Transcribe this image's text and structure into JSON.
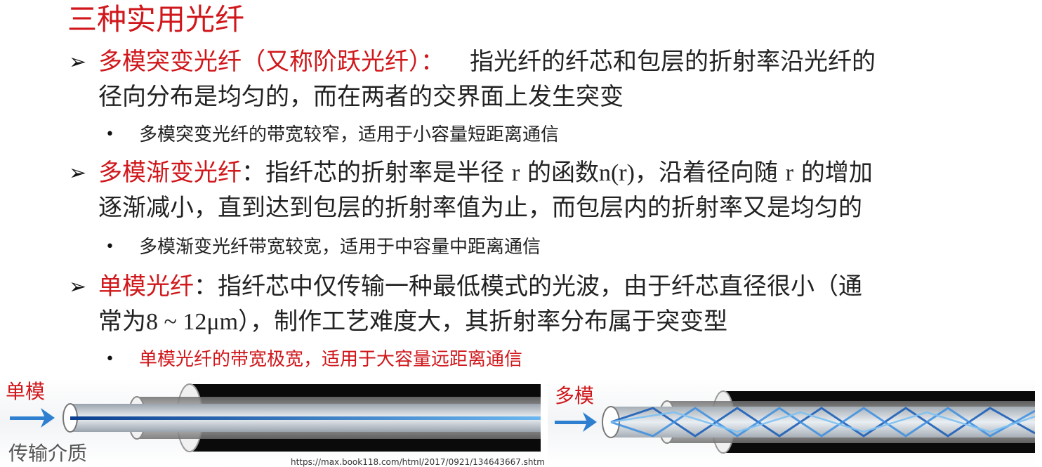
{
  "title": "三种实用光纤",
  "items": [
    {
      "head": "多模突变光纤（又称阶跃光纤）：",
      "line1": "指光纤的纤芯和包层的折射率沿光纤的",
      "line2": "径向分布是均匀的，而在两者的交界面上发生突变",
      "sub": "多模突变光纤的带宽较窄，适用于小容量短距离通信"
    },
    {
      "head": "多模渐变光纤",
      "line1_a": "：指纤芯的折射率是半径",
      "line1_r1": "r",
      "line1_b": "的函数",
      "line1_n": "n(r)",
      "line1_c": "，沿着径向随",
      "line1_r2": "r",
      "line1_d": "的增加",
      "line2": "逐渐减小，直到达到包层的折射率值为止，而包层内的折射率又是均匀的",
      "sub": "多模渐变光纤带宽较宽，适用于中容量中距离通信"
    },
    {
      "head": "单模光纤",
      "line1": "：指纤芯中仅传输一种最低模式的光波，由于纤芯直径很小（通",
      "line2_a": "常为",
      "line2_num": "8 ~ 12μm",
      "line2_b": "），制作工艺难度大，其折射率分布属于突变型",
      "sub": "单模光纤的带宽极宽，适用于大容量远距离通信"
    }
  ],
  "figure": {
    "single_label": "单模",
    "multi_label": "多模",
    "medium_label": "传输介质",
    "source_url": "https://max.book118.com/html/2017/0921/134643667.shtm"
  },
  "colors": {
    "accent_red": "#d0171b",
    "arrow_blue": "#2f7fd0",
    "fiber_black": "#0a0a0a"
  }
}
